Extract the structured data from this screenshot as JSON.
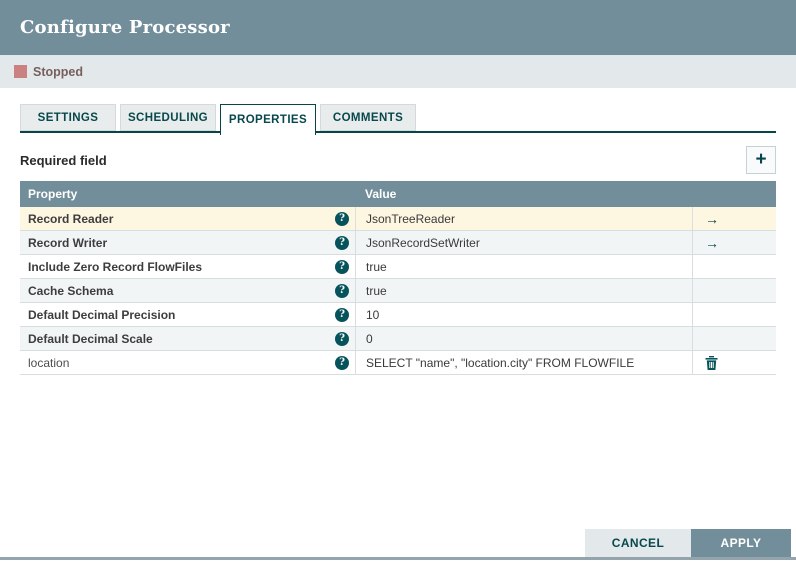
{
  "dialog": {
    "title": "Configure Processor"
  },
  "status": {
    "label": "Stopped",
    "swatch_color": "#ca8181"
  },
  "tabs": [
    {
      "label": "SETTINGS",
      "active": false
    },
    {
      "label": "SCHEDULING",
      "active": false
    },
    {
      "label": "PROPERTIES",
      "active": true
    },
    {
      "label": "COMMENTS",
      "active": false
    }
  ],
  "toolbar": {
    "required_field_label": "Required field"
  },
  "icons": {
    "add": "+",
    "help": "?",
    "go_to": "→",
    "trash": "trash-icon"
  },
  "table": {
    "columns": [
      "Property",
      "Value"
    ],
    "rows": [
      {
        "property": "Record Reader",
        "value": "JsonTreeReader",
        "action": "go-to",
        "required": true,
        "highlighted": true
      },
      {
        "property": "Record Writer",
        "value": "JsonRecordSetWriter",
        "action": "go-to",
        "required": true,
        "highlighted": false
      },
      {
        "property": "Include Zero Record FlowFiles",
        "value": "true",
        "action": "none",
        "required": true,
        "highlighted": false
      },
      {
        "property": "Cache Schema",
        "value": "true",
        "action": "none",
        "required": true,
        "highlighted": false
      },
      {
        "property": "Default Decimal Precision",
        "value": "10",
        "action": "none",
        "required": true,
        "highlighted": false
      },
      {
        "property": "Default Decimal Scale",
        "value": "0",
        "action": "none",
        "required": true,
        "highlighted": false
      },
      {
        "property": "location",
        "value": "SELECT \"name\", \"location.city\" FROM FLOWFILE",
        "action": "delete",
        "required": false,
        "highlighted": false
      }
    ]
  },
  "buttons": {
    "cancel": "CANCEL",
    "apply": "APPLY"
  },
  "colors": {
    "header_bg": "#728e9b",
    "status_bg": "#e3e8ea",
    "accent_teal": "#07484c",
    "row_alt_bg": "#f2f5f6",
    "row_highlight_bg": "#fdf6e0",
    "apply_bg": "#728e9b",
    "cancel_bg": "#e3e8eb"
  }
}
